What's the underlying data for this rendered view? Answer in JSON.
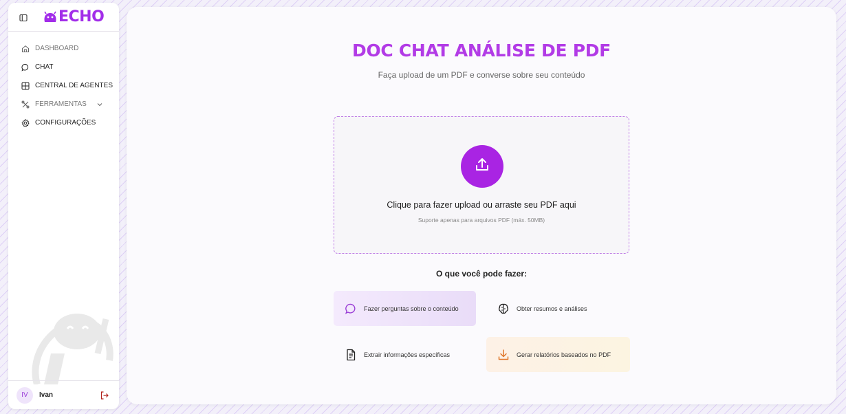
{
  "app": {
    "logo_text": "ECHO",
    "brand_color": "#a22de9"
  },
  "sidebar": {
    "items": [
      {
        "label": "DASHBOARD",
        "icon": "home-icon"
      },
      {
        "label": "CHAT",
        "icon": "chat-bubble-icon"
      },
      {
        "label": "CENTRAL DE AGENTES",
        "icon": "grid-icon"
      },
      {
        "label": "FERRAMENTAS",
        "icon": "tools-icon",
        "expandable": true
      },
      {
        "label": "CONFIGURAÇÕES",
        "icon": "gear-icon"
      }
    ],
    "user": {
      "initials": "IV",
      "name": "Ivan"
    }
  },
  "main": {
    "title": "DOC CHAT ANÁLISE DE PDF",
    "subtitle": "Faça upload de um PDF e converse sobre seu conteúdo",
    "upload": {
      "text": "Clique para fazer upload ou arraste seu PDF aqui",
      "note": "Suporte apenas para arquivos PDF (máx. 50MB)"
    },
    "features_title": "O que você pode fazer:",
    "features": [
      {
        "label": "Fazer perguntas sobre o conteúdo",
        "icon": "chat-bubble-icon",
        "color": "#9b3fd6"
      },
      {
        "label": "Obter resumos e análises",
        "icon": "brain-icon",
        "color": "#222222"
      },
      {
        "label": "Extrair informações específicas",
        "icon": "document-icon",
        "color": "#222222"
      },
      {
        "label": "Gerar relatórios baseados no PDF",
        "icon": "download-icon",
        "color": "#e0782c"
      }
    ]
  }
}
